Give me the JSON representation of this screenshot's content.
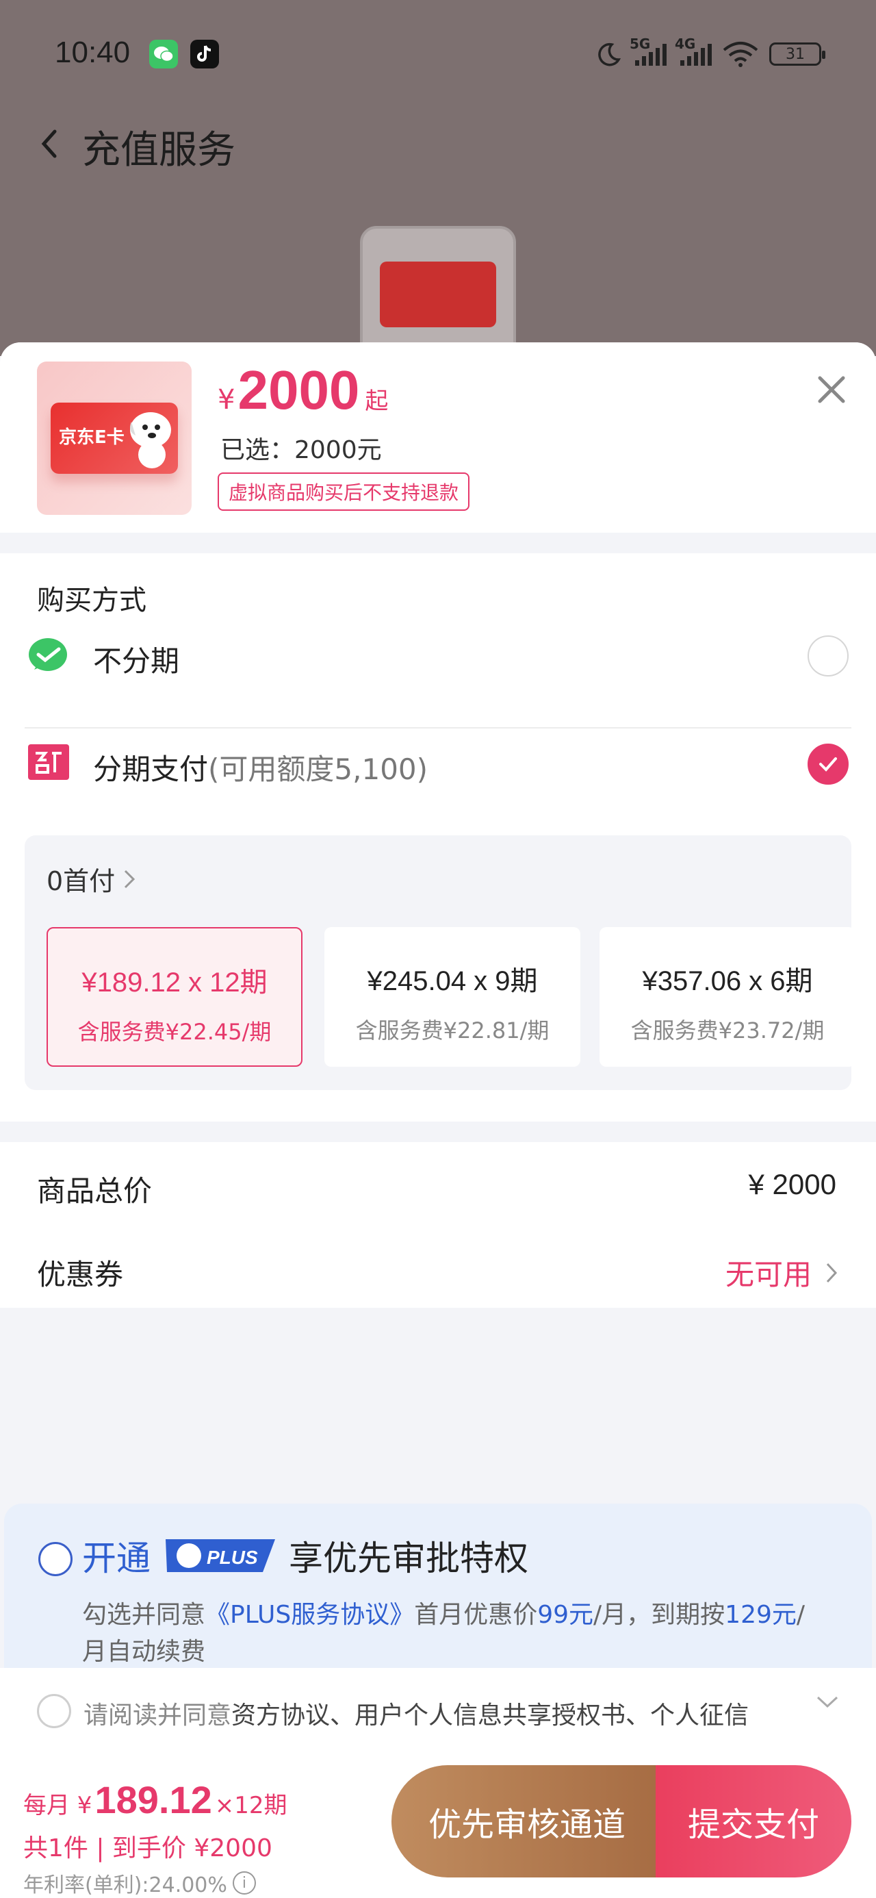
{
  "status_bar": {
    "time": "10:40",
    "battery": "31",
    "sig1_label": "5G",
    "sig2_label": "4G"
  },
  "nav": {
    "title": "充值服务"
  },
  "product": {
    "card_text": "京东E卡",
    "price_symbol": "¥",
    "price": "2000",
    "price_suffix": "起",
    "selected": "已选：2000元",
    "refund_note": "虚拟商品购买后不支持退款"
  },
  "purchase": {
    "title": "购买方式",
    "option_full": "不分期",
    "option_installment": "分期支付",
    "option_installment_sub": "(可用额度5,100)",
    "down_payment": "0首付",
    "plans": [
      {
        "main": "¥189.12 x 12期",
        "fee": "含服务费¥22.45/期",
        "selected": true
      },
      {
        "main": "¥245.04 x 9期",
        "fee": "含服务费¥22.81/期",
        "selected": false
      },
      {
        "main": "¥357.06 x 6期",
        "fee": "含服务费¥23.72/期",
        "selected": false
      }
    ]
  },
  "summary": {
    "total_label": "商品总价",
    "total_value": "¥ 2000",
    "coupon_label": "优惠券",
    "coupon_value": "无可用"
  },
  "plus": {
    "open": "开通",
    "badge": "PLUS",
    "title_rest": "享优先审批特权",
    "desc_1": "勾选并同意",
    "desc_link": "《PLUS服务协议》",
    "desc_2": "首月优惠价",
    "desc_price1": "99元",
    "desc_3": "/月，到期按",
    "desc_price2": "129元",
    "desc_4": "/月自动续费"
  },
  "agreement": {
    "prefix": "请阅读并同意",
    "docs": "资方协议、用户个人信息共享授权书、个人征信"
  },
  "footer": {
    "monthly_prefix": "每月 ¥",
    "monthly_amount": "189.12",
    "monthly_suffix": "×12期",
    "count_line": "共1件 | 到手价 ¥2000",
    "rate_line": "年利率(单利):24.00%",
    "priority_btn": "优先审核通道",
    "submit_btn": "提交支付"
  },
  "colors": {
    "accent": "#e6396b",
    "plus_blue": "#2f5fd0",
    "wechat_green": "#3cc566"
  }
}
